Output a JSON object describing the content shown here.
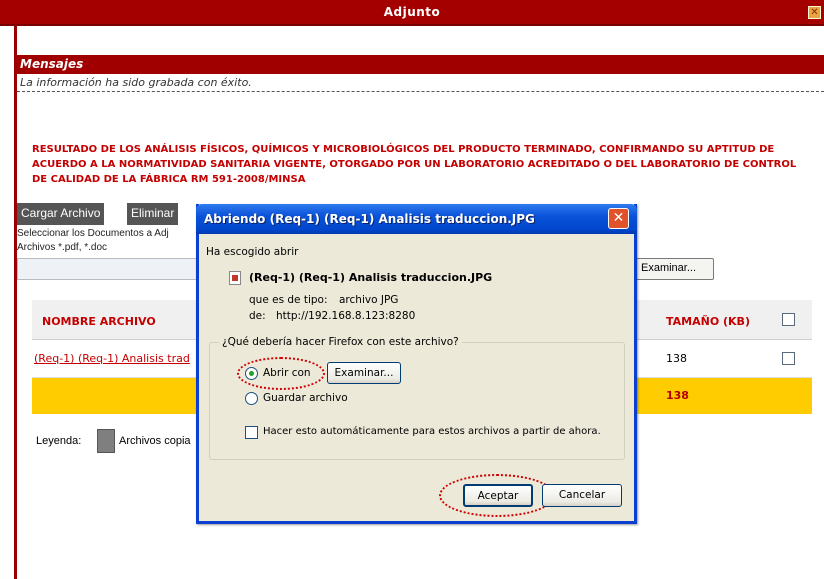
{
  "window": {
    "title": "Adjunto",
    "close_glyph": "✕"
  },
  "messages": {
    "header": "Mensajes",
    "text": "La información ha sido grabada con éxito."
  },
  "heading": "RESULTADO DE LOS ANÁLISIS FÍSICOS, QUÍMICOS Y MICROBIOLÓGICOS DEL PRODUCTO TERMINADO, CONFIRMANDO SU APTITUD DE ACUERDO A LA NORMATIVIDAD SANITARIA VIGENTE, OTORGADO POR UN LABORATORIO ACREDITADO O DEL LABORATORIO DE CONTROL DE CALIDAD DE LA FÁBRICA RM 591-2008/MINSA",
  "toolbar": {
    "upload_label": "Cargar Archivo",
    "delete_label": "Eliminar"
  },
  "upload": {
    "instruction": "Seleccionar los Documentos a Adj",
    "types": "Archivos *.pdf, *.doc",
    "browse_label": "Examinar..."
  },
  "table": {
    "col_name": "NOMBRE ARCHIVO",
    "col_size": "TAMAÑO (KB)",
    "rows": [
      {
        "name": "(Req-1) (Req-1) Analisis trad",
        "size": "138"
      }
    ],
    "total": "138"
  },
  "legend": {
    "label": "Leyenda:",
    "item": "Archivos copia"
  },
  "dialog": {
    "title": "Abriendo (Req-1) (Req-1) Analisis traduccion.JPG",
    "intro": "Ha escogido abrir",
    "filename": "(Req-1) (Req-1) Analisis traduccion.JPG",
    "type_label": "que es de tipo:",
    "type_value": "archivo JPG",
    "from_label": "de:",
    "from_value": "http://192.168.8.123:8280",
    "question": "¿Qué debería hacer Firefox con este archivo?",
    "open_with": "Abrir con",
    "browse_label": "Examinar...",
    "save_file": "Guardar archivo",
    "auto_label": "Hacer esto automáticamente para estos archivos a partir de ahora.",
    "accept_label": "Aceptar",
    "cancel_label": "Cancelar"
  },
  "colors": {
    "brand_red": "#a00000",
    "dialog_blue": "#0a52d8",
    "total_yellow": "#ffcc00"
  }
}
